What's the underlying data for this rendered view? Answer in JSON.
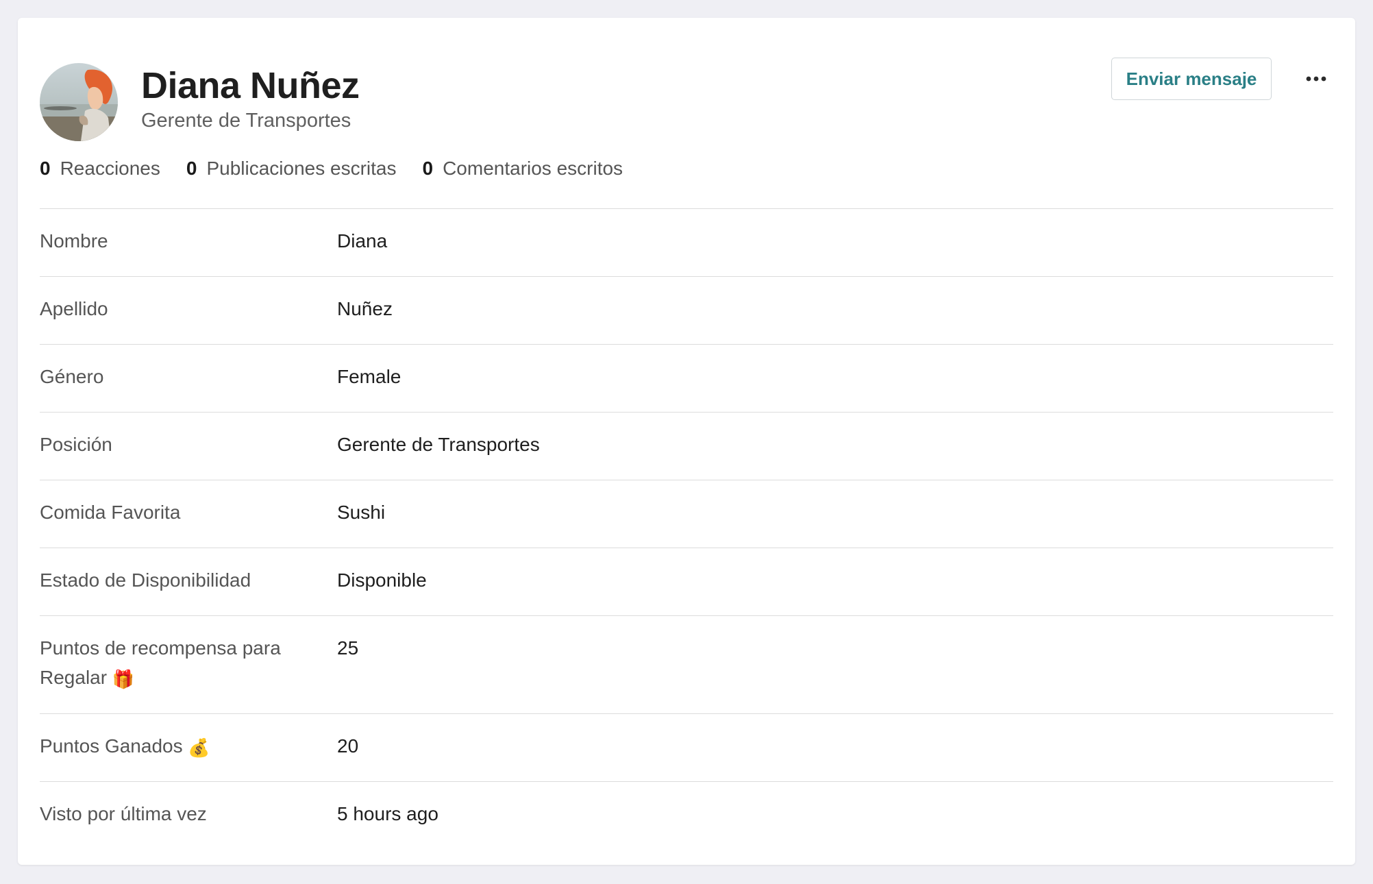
{
  "profile": {
    "name": "Diana Nuñez",
    "subtitle": "Gerente de Transportes",
    "send_message_label": "Enviar mensaje",
    "more_icon": "ellipsis-icon",
    "avatar_icon": "user-avatar"
  },
  "stats": [
    {
      "count": "0",
      "label": "Reacciones"
    },
    {
      "count": "0",
      "label": "Publicaciones escritas"
    },
    {
      "count": "0",
      "label": "Comentarios escritos"
    }
  ],
  "fields": [
    {
      "label": "Nombre",
      "value": "Diana"
    },
    {
      "label": "Apellido",
      "value": "Nuñez"
    },
    {
      "label": "Género",
      "value": "Female"
    },
    {
      "label": "Posición",
      "value": "Gerente de Transportes"
    },
    {
      "label": "Comida Favorita",
      "value": "Sushi"
    },
    {
      "label": "Estado de Disponibilidad",
      "value": "Disponible"
    },
    {
      "label": "Puntos de recompensa para Regalar",
      "emoji": "🎁",
      "value": "25"
    },
    {
      "label": "Puntos Ganados",
      "emoji": "💰",
      "value": "20"
    },
    {
      "label": "Visto por última vez",
      "value": "5 hours ago"
    }
  ],
  "colors": {
    "accent": "#2a7f86",
    "background": "#efeff4",
    "card": "#ffffff",
    "divider": "#dcdcdc"
  }
}
